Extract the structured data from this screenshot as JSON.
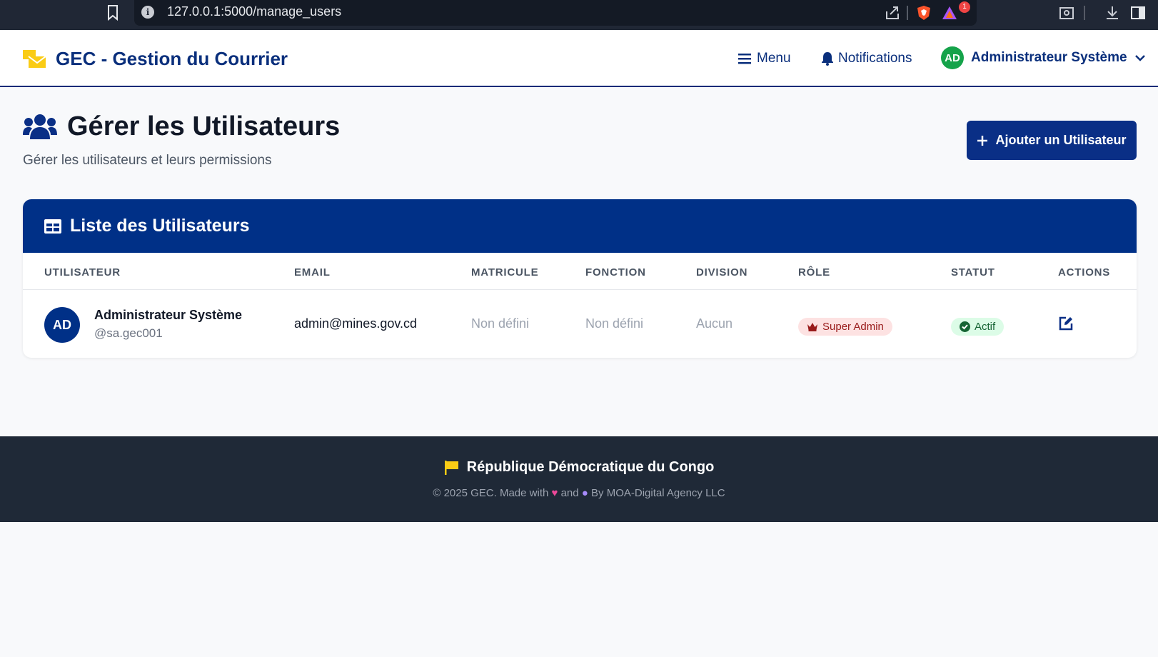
{
  "browser": {
    "url": "127.0.0.1:5000/manage_users",
    "info_icon": "info-icon",
    "brave_badge_count": "1"
  },
  "header": {
    "app_title": "GEC - Gestion du Courrier",
    "menu_label": "Menu",
    "notifications_label": "Notifications",
    "user_initials": "AD",
    "user_name": "Administrateur Système"
  },
  "page": {
    "title": "Gérer les Utilisateurs",
    "subtitle": "Gérer les utilisateurs et leurs permissions",
    "add_button_label": "Ajouter un Utilisateur"
  },
  "users_table": {
    "title": "Liste des Utilisateurs",
    "columns": [
      "UTILISATEUR",
      "EMAIL",
      "MATRICULE",
      "FONCTION",
      "DIVISION",
      "RÔLE",
      "STATUT",
      "ACTIONS"
    ],
    "rows": [
      {
        "initials": "AD",
        "name": "Administrateur Système",
        "username": "@sa.gec001",
        "email": "admin@mines.gov.cd",
        "matricule": "Non défini",
        "fonction": "Non défini",
        "division": "Aucun",
        "role": "Super Admin",
        "status": "Actif"
      }
    ]
  },
  "footer": {
    "country": "République Démocratique du Congo",
    "copyright_prefix": "© 2025 GEC. Made with",
    "and": "and",
    "by": "By MOA-Digital Agency LLC"
  },
  "colors": {
    "primary": "#003087",
    "header_text": "#0a2f7c",
    "avatar_green": "#15a34a",
    "footer_bg": "#1f2937",
    "role_badge_bg": "#fde2e2",
    "status_badge_bg": "#dcfce7"
  }
}
